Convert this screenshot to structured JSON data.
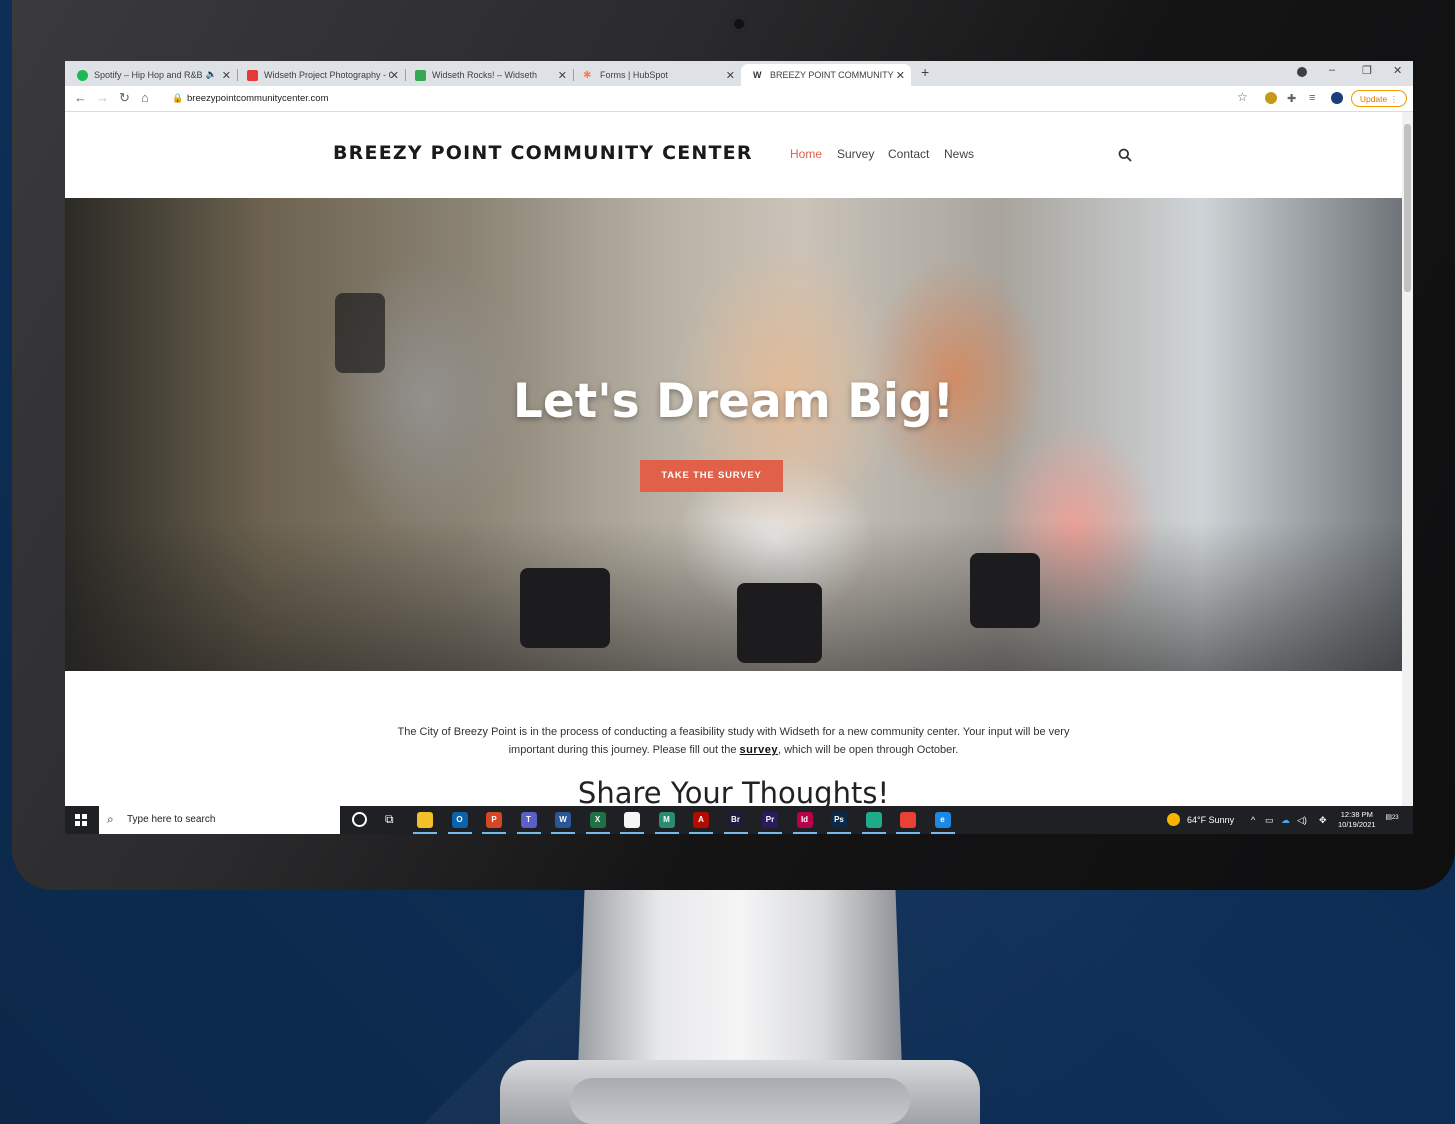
{
  "browser": {
    "tabs": [
      {
        "title": "Spotify – Hip Hop and R&B",
        "icon_color": "#1db954",
        "icon": "spotify-icon"
      },
      {
        "title": "Widseth Project Photography - G",
        "icon_color": "#e53935",
        "icon": "photo-icon"
      },
      {
        "title": "Widseth Rocks! – Widseth",
        "icon_color": "#34a853",
        "icon": "sheet-icon"
      },
      {
        "title": "Forms | HubSpot",
        "icon_color": "#ff7a59",
        "icon": "hubspot-icon"
      },
      {
        "title": "BREEZY POINT COMMUNITY CE",
        "icon_color": "#333333",
        "icon": "site-icon"
      }
    ],
    "new_tab": "+",
    "url": "breezypointcommunitycenter.com",
    "update_label": "Update"
  },
  "site": {
    "title": "BREEZY POINT COMMUNITY CENTER",
    "nav": [
      "Home",
      "Survey",
      "Contact",
      "News"
    ],
    "accent": "#e0604a"
  },
  "hero": {
    "headline": "Let's Dream Big!",
    "cta": "TAKE THE SURVEY"
  },
  "content": {
    "intro_line1": "The City of Breezy Point is in the process of conducting a feasibility study with Widseth for a new community center. Your input will be very",
    "intro_line2_before": "important during this journey. Please fill out the ",
    "intro_link": "survey",
    "intro_line2_after": ", which will be open through October.",
    "section_heading": "Share Your Thoughts!"
  },
  "taskbar": {
    "search_placeholder": "Type here to search",
    "apps": [
      {
        "name": "file-explorer-icon",
        "label": "",
        "color": "#f2c028"
      },
      {
        "name": "outlook-icon",
        "label": "O",
        "color": "#0a64ad"
      },
      {
        "name": "powerpoint-icon",
        "label": "P",
        "color": "#d24726"
      },
      {
        "name": "teams-icon",
        "label": "T",
        "color": "#5b5fc7"
      },
      {
        "name": "word-icon",
        "label": "W",
        "color": "#2b5797"
      },
      {
        "name": "excel-icon",
        "label": "X",
        "color": "#1e7145"
      },
      {
        "name": "notepad-icon",
        "label": "",
        "color": "#f5f5f5"
      },
      {
        "name": "miro-icon",
        "label": "M",
        "color": "#2a8c6a"
      },
      {
        "name": "acrobat-icon",
        "label": "A",
        "color": "#b30b00"
      },
      {
        "name": "bridge-icon",
        "label": "Br",
        "color": "#1b1b3a"
      },
      {
        "name": "premiere-icon",
        "label": "Pr",
        "color": "#2a1a5e"
      },
      {
        "name": "indesign-icon",
        "label": "Id",
        "color": "#b8004c"
      },
      {
        "name": "photoshop-icon",
        "label": "Ps",
        "color": "#0a2a4a"
      },
      {
        "name": "edge-icon",
        "label": "",
        "color": "#1faa8a"
      },
      {
        "name": "chrome-icon",
        "label": "",
        "color": "#e94235"
      },
      {
        "name": "ie-icon",
        "label": "e",
        "color": "#1e88e5"
      }
    ],
    "weather": "64°F  Sunny",
    "time": "12:38 PM",
    "date": "10/19/2021",
    "notification_count": "23"
  }
}
